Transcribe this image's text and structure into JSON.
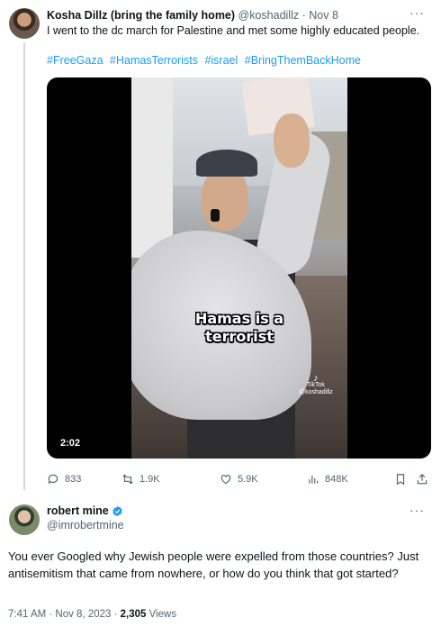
{
  "parent_tweet": {
    "author_name": "Kosha Dillz (bring the family home)",
    "author_handle": "@koshadillz",
    "separator": "·",
    "date": "Nov 8",
    "text": "I went to the dc march for Palestine and met some highly educated people.",
    "hashtags": [
      "#FreeGaza",
      "#HamasTerrorists",
      "#israel",
      "#BringThemBackHome"
    ],
    "video": {
      "caption_line1": "Hamas is a",
      "caption_line2": "terrorist",
      "duration": "2:02",
      "watermark_brand": "TikTok",
      "watermark_handle": "@koshadillz"
    },
    "actions": {
      "replies": "833",
      "reposts": "1.9K",
      "likes": "5.9K",
      "views": "848K"
    },
    "more_label": "···"
  },
  "main_tweet": {
    "author_name": "robert mine",
    "author_handle": "@imrobertmine",
    "verified": true,
    "text": "You ever Googled why Jewish people were expelled from those countries? Just antisemitism that came from nowhere, or how do you think that got started?",
    "timestamp": "7:41 AM · Nov 8, 2023 · ",
    "views_count": "2,305",
    "views_label": " Views",
    "more_label": "···"
  },
  "colors": {
    "accent": "#1d9bf0",
    "secondary_text": "#536471",
    "primary_text": "#0f1419",
    "thread_line": "#cfd9de"
  }
}
